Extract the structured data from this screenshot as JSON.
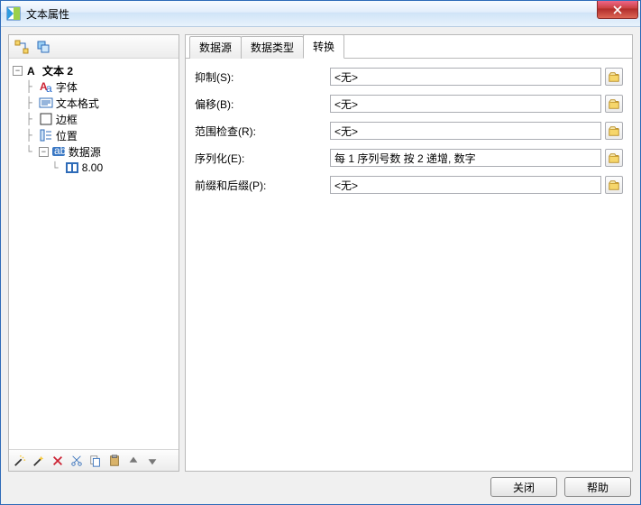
{
  "window": {
    "title": "文本属性"
  },
  "left_toolbar": {
    "icons": [
      "connector-icon",
      "cascade-icon"
    ]
  },
  "tree": {
    "root": {
      "label": "文本 2"
    },
    "children": [
      {
        "label": "字体",
        "icon": "font-icon"
      },
      {
        "label": "文本格式",
        "icon": "textformat-icon"
      },
      {
        "label": "边框",
        "icon": "border-icon"
      },
      {
        "label": "位置",
        "icon": "position-icon"
      },
      {
        "label": "数据源",
        "icon": "datasource-icon",
        "expanded": true,
        "children": [
          {
            "label": "8.00",
            "icon": "datavalue-icon"
          }
        ]
      }
    ]
  },
  "bottom_toolbar": {
    "icons": [
      "wand",
      "sparkwand",
      "delete",
      "cut",
      "copy",
      "paste",
      "up",
      "down"
    ]
  },
  "tabs": [
    {
      "id": "src",
      "label": "数据源"
    },
    {
      "id": "type",
      "label": "数据类型"
    },
    {
      "id": "trans",
      "label": "转换",
      "active": true
    }
  ],
  "form": {
    "rows": [
      {
        "label": "抑制(S):",
        "value": "<无>"
      },
      {
        "label": "偏移(B):",
        "value": "<无>"
      },
      {
        "label": "范围检查(R):",
        "value": "<无>"
      },
      {
        "label": "序列化(E):",
        "value": "每 1 序列号数 按 2 递增, 数字"
      },
      {
        "label": "前缀和后缀(P):",
        "value": "<无>"
      }
    ]
  },
  "footer": {
    "close": "关闭",
    "help": "帮助"
  }
}
